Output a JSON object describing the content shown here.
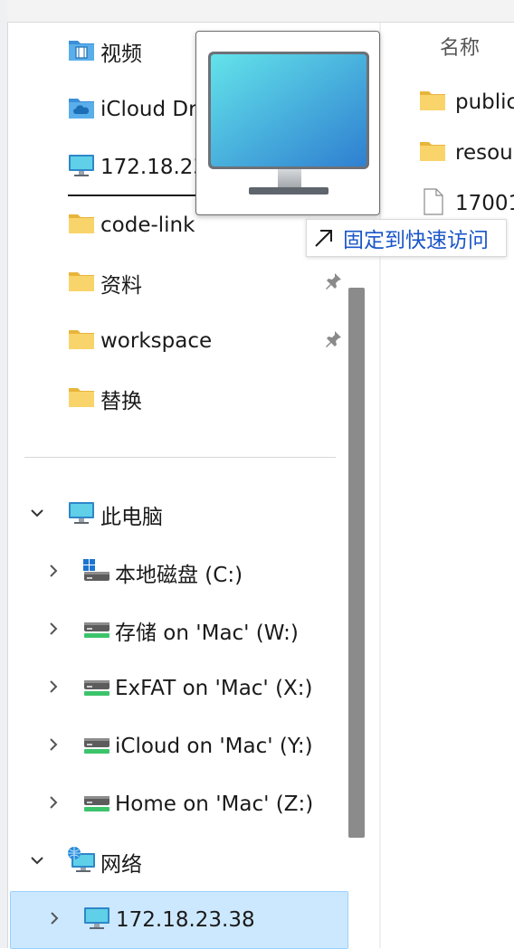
{
  "nav": {
    "quick_access": [
      {
        "label": "视频",
        "icon": "video-folder-icon",
        "pinned": false
      },
      {
        "label": "iCloud Dr",
        "icon": "icloud-folder-icon",
        "pinned": false
      },
      {
        "label": "172.18.23",
        "icon": "monitor-icon",
        "pinned": false
      },
      {
        "label": "code-link",
        "icon": "folder-icon",
        "pinned": true
      },
      {
        "label": "资料",
        "icon": "folder-icon",
        "pinned": true
      },
      {
        "label": "workspace",
        "icon": "folder-icon",
        "pinned": true
      },
      {
        "label": "替换",
        "icon": "folder-icon",
        "pinned": false
      }
    ],
    "this_pc": {
      "label": "此电脑",
      "drives": [
        {
          "label": "本地磁盘 (C:)",
          "icon": "windows-drive-icon"
        },
        {
          "label": "存储 on 'Mac' (W:)",
          "icon": "network-drive-icon"
        },
        {
          "label": "ExFAT on 'Mac' (X:)",
          "icon": "network-drive-icon"
        },
        {
          "label": "iCloud on 'Mac' (Y:)",
          "icon": "network-drive-icon"
        },
        {
          "label": "Home on 'Mac' (Z:)",
          "icon": "network-drive-icon"
        }
      ]
    },
    "network": {
      "label": "网络",
      "items": [
        {
          "label": "172.18.23.38",
          "icon": "monitor-icon",
          "selected": true
        }
      ]
    }
  },
  "content": {
    "column_header": "名称",
    "files": [
      {
        "label": "public",
        "icon": "folder-icon"
      },
      {
        "label": "resou",
        "icon": "folder-icon"
      },
      {
        "label": "17001",
        "icon": "file-icon"
      }
    ]
  },
  "tooltip": {
    "pin_label": "固定到快速访问"
  },
  "colors": {
    "selection_bg": "#cce8ff",
    "tooltip_text": "#1a56c8",
    "folder_yellow": "#f9d46b",
    "scrollbar": "#8b8b8b"
  }
}
